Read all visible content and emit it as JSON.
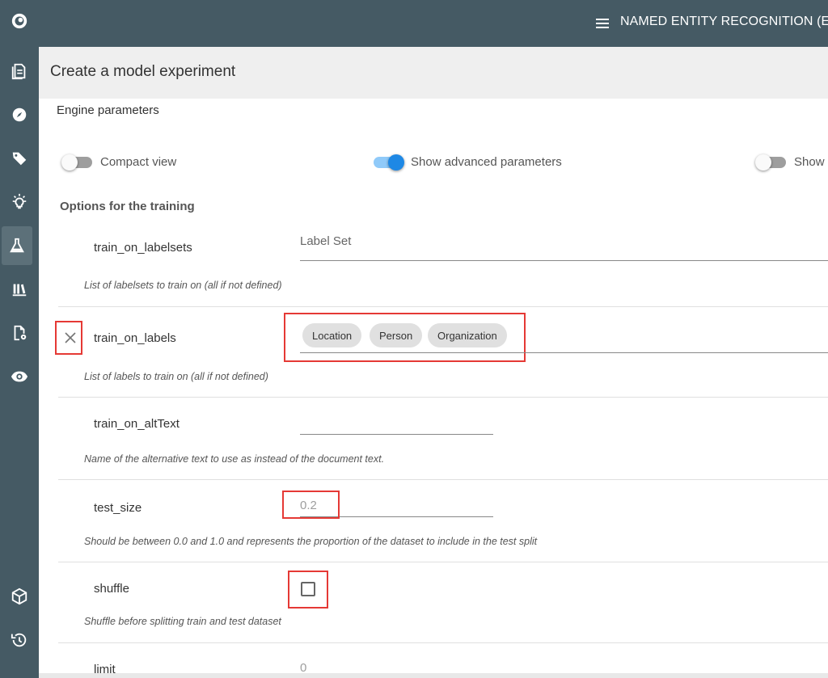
{
  "header": {
    "title": "NAMED ENTITY RECOGNITION (ENGL",
    "menu_icon": "hamburger-menu-icon"
  },
  "sidebar": {
    "items": [
      {
        "icon": "logo-eye-icon"
      },
      {
        "icon": "document-icon"
      },
      {
        "icon": "compass-icon"
      },
      {
        "icon": "tag-icon"
      },
      {
        "icon": "lightbulb-icon"
      },
      {
        "icon": "flask-icon",
        "active": true
      },
      {
        "icon": "library-icon"
      },
      {
        "icon": "document-settings-icon"
      },
      {
        "icon": "eye-settings-icon"
      },
      {
        "icon": "cube-icon"
      },
      {
        "icon": "history-icon"
      }
    ]
  },
  "page": {
    "title": "Create a model experiment"
  },
  "engine": {
    "section_title": "Engine parameters",
    "toggles": {
      "compact_view": {
        "label": "Compact view",
        "on": false
      },
      "show_advanced": {
        "label": "Show advanced parameters",
        "on": true
      },
      "show_other": {
        "label": "Show",
        "on": false
      }
    },
    "options_title": "Options for the training",
    "params": {
      "train_on_labelsets": {
        "name": "train_on_labelsets",
        "field_label": "Label Set",
        "description": "List of labelsets to train on (all if not defined)"
      },
      "train_on_labels": {
        "name": "train_on_labels",
        "chips": [
          "Location",
          "Person",
          "Organization"
        ],
        "description": "List of labels to train on (all if not defined)"
      },
      "train_on_altText": {
        "name": "train_on_altText",
        "value": "",
        "description": "Name of the alternative text to use as instead of the document text."
      },
      "test_size": {
        "name": "test_size",
        "value": "0.2",
        "description": "Should be between 0.0 and 1.0 and represents the proportion of the dataset to include in the test split"
      },
      "shuffle": {
        "name": "shuffle",
        "checked": false,
        "description": "Shuffle before splitting train and test dataset"
      },
      "limit": {
        "name": "limit",
        "value": "0"
      }
    }
  },
  "colors": {
    "sidebar_bg": "#455a64",
    "subheader_bg": "#efefef",
    "accent": "#1e88e5",
    "highlight": "#e53935"
  }
}
